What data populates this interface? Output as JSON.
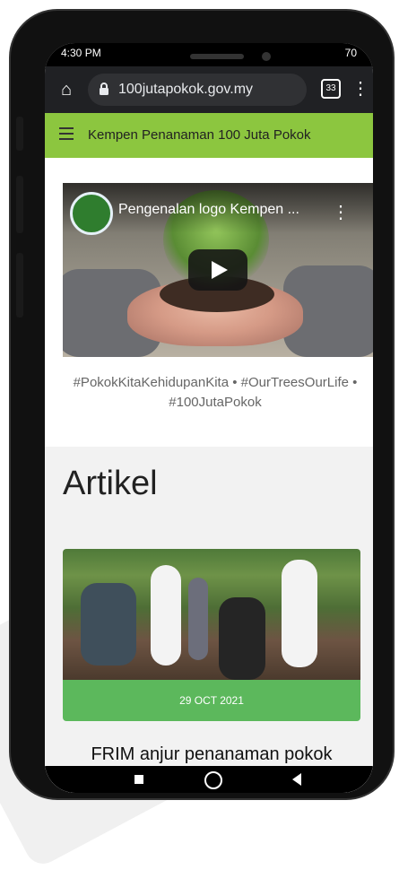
{
  "status_bar": {
    "time": "4:30 PM",
    "battery": "70"
  },
  "browser": {
    "url": "100jutapokok.gov.my",
    "tab_count": "33"
  },
  "site": {
    "header_title": "Kempen Penanaman 100 Juta Pokok"
  },
  "video": {
    "title": "Pengenalan logo Kempen ..."
  },
  "hashtags": "#PokokKitaKehidupanKita  •  #OurTreesOurLife  •  #100JutaPokok",
  "articles": {
    "section_title": "Artikel",
    "items": [
      {
        "date": "29 OCT 2021",
        "title": "FRIM anjur penanaman pokok"
      }
    ]
  },
  "icons": {
    "home": "home-icon",
    "lock": "lock-icon",
    "menu": "menu-icon",
    "tabs": "tabs-icon",
    "video_menu": "more-vert-icon",
    "play": "play-icon"
  }
}
